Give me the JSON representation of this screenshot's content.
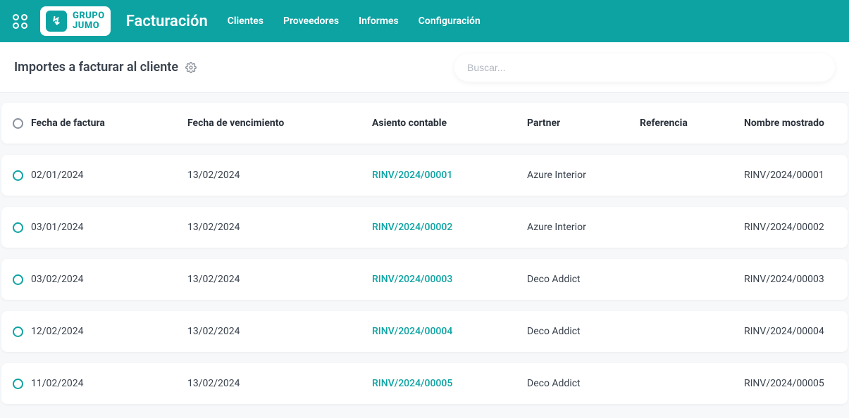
{
  "brand": {
    "mark_line1": "GRUPO",
    "mark_line2": "JUMO",
    "glyph": "↯"
  },
  "app_title": "Facturación",
  "nav": [
    {
      "label": "Clientes"
    },
    {
      "label": "Proveedores"
    },
    {
      "label": "Informes"
    },
    {
      "label": "Configuración"
    }
  ],
  "breadcrumb": "Importes a facturar al cliente",
  "search": {
    "placeholder": "Buscar..."
  },
  "columns": {
    "invoice_date": "Fecha de factura",
    "due_date": "Fecha de vencimiento",
    "entry": "Asiento contable",
    "partner": "Partner",
    "ref": "Referencia",
    "display_name": "Nombre mostrado"
  },
  "rows": [
    {
      "invoice_date": "02/01/2024",
      "due_date": "13/02/2024",
      "entry": "RINV/2024/00001",
      "partner": "Azure Interior",
      "ref": "",
      "display_name": "RINV/2024/00001"
    },
    {
      "invoice_date": "03/01/2024",
      "due_date": "13/02/2024",
      "entry": "RINV/2024/00002",
      "partner": "Azure Interior",
      "ref": "",
      "display_name": "RINV/2024/00002"
    },
    {
      "invoice_date": "03/02/2024",
      "due_date": "13/02/2024",
      "entry": "RINV/2024/00003",
      "partner": "Deco Addict",
      "ref": "",
      "display_name": "RINV/2024/00003"
    },
    {
      "invoice_date": "12/02/2024",
      "due_date": "13/02/2024",
      "entry": "RINV/2024/00004",
      "partner": "Deco Addict",
      "ref": "",
      "display_name": "RINV/2024/00004"
    },
    {
      "invoice_date": "11/02/2024",
      "due_date": "13/02/2024",
      "entry": "RINV/2024/00005",
      "partner": "Deco Addict",
      "ref": "",
      "display_name": "RINV/2024/00005"
    }
  ]
}
